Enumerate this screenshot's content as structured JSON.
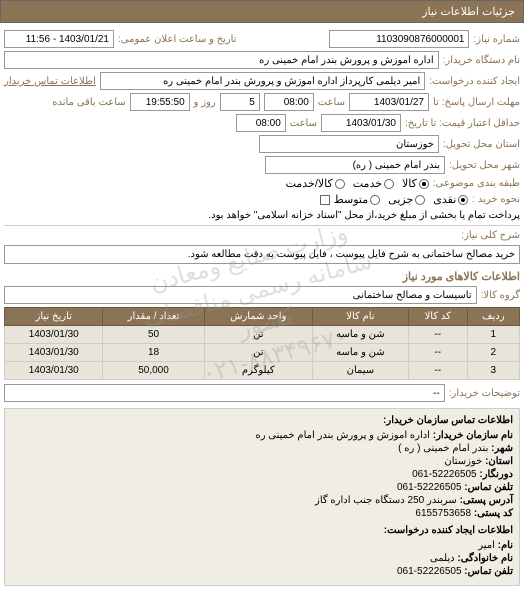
{
  "header": {
    "title": "جزئیات اطلاعات نیاز"
  },
  "main": {
    "req_no_label": "شماره نیاز:",
    "req_no": "1103090876000001",
    "pub_date_label": "تاریخ و ساعت اعلان عمومی:",
    "pub_date": "1403/01/21 - 11:56",
    "buyer_org_label": "نام دستگاه خریدار:",
    "buyer_org": "اداره اموزش و پرورش بندر امام خمینی  ره",
    "requester_label": "ایجاد کننده درخواست:",
    "requester": "امیر دیلمی کارپرداز اداره اموزش و پرورش بندر امام خمینی  ره",
    "contact_link": "اطلاعات تماس خریدار",
    "deadline_label": "مهلت ارسال پاسخ: تا",
    "deadline_date": "1403/01/27",
    "deadline_time_label": "ساعت",
    "deadline_time": "08:00",
    "remaining_label1": "روز و",
    "remaining_days": "5",
    "remaining_label2": "ساعت باقی مانده",
    "remaining_time": "19:55:50",
    "validity_label": "حداقل اعتبار قیمت: تا تاریخ:",
    "validity_date": "1403/01/30",
    "validity_time_label": "ساعت",
    "validity_time": "08:00",
    "province_label": "استان محل تحویل:",
    "province": "خوزستان",
    "city_label": "شهر محل تحویل:",
    "city": "بندر امام خمینی ( ره)",
    "cat_label": "طبقه بندی موضوعی:",
    "cat_opts": {
      "a": "کالا",
      "b": "خدمت",
      "c": "کالا/خدمت"
    },
    "pay_label": "نحوه خرید :",
    "pay_opts": {
      "a": "نقدی",
      "b": "جزیی",
      "c": "متوسط"
    },
    "pay_note": "پرداخت تمام یا بخشی از مبلغ خرید،از محل \"اسناد خزانه اسلامی\" خواهد بود.",
    "desc_label": "شرح کلی نیاز:",
    "desc": "خرید مصالح ساختمانی به شرح فایل پیوست ، فایل پیوست به دقت مطالعه شود.",
    "goods_title": "اطلاعات کالاهای مورد نیاز",
    "goods_group_label": "گروه کالا:",
    "goods_group": "تاسیسات و مصالح ساختمانی",
    "table": {
      "headers": [
        "ردیف",
        "کد کالا",
        "نام کالا",
        "واحد شمارش",
        "تعداد / مقدار",
        "تاریخ نیاز"
      ],
      "rows": [
        {
          "n": "1",
          "code": "--",
          "name": "شن و ماسه",
          "unit": "تن",
          "qty": "50",
          "date": "1403/01/30"
        },
        {
          "n": "2",
          "code": "--",
          "name": "شن و ماسه",
          "unit": "تن",
          "qty": "18",
          "date": "1403/01/30"
        },
        {
          "n": "3",
          "code": "--",
          "name": "سیمان",
          "unit": "کیلوگرم",
          "qty": "50,000",
          "date": "1403/01/30"
        }
      ]
    },
    "buyer_notes_label": "توضیحات خریدار:",
    "buyer_notes": "--"
  },
  "footer": {
    "sec1_title": "اطلاعات تماس سازمان خریدار:",
    "org_label": "نام سازمان خریدار:",
    "org": "اداره اموزش و پرورش بندر امام خمینی ره",
    "city_label": "شهر:",
    "city": "بندر امام خمینی ( ره )",
    "province_label": "استان:",
    "province": "خوزستان",
    "fax_label": "دورنگار:",
    "fax": "52226505-061",
    "phone_label": "تلفن تماس:",
    "phone": "52226505-061",
    "addr_label": "آدرس پستی:",
    "addr": "سربندر 250 دستگاه جنب اداره گاز",
    "zip_label": "کد پستی:",
    "zip": "6155753658",
    "sec2_title": "اطلاعات ایجاد کننده درخواست:",
    "fname_label": "نام:",
    "fname": "امیر",
    "lname_label": "نام خانوادگی:",
    "lname": "دیلمی",
    "cphone_label": "تلفن تماس:",
    "cphone": "52226505-061"
  },
  "watermark": {
    "line1": "وزارت صنایع ومعادن",
    "line2": "سامانه رسمی مناقصات کشور",
    "line3": "۰۲۱-۸۸۳۴۹۶۷۰"
  }
}
